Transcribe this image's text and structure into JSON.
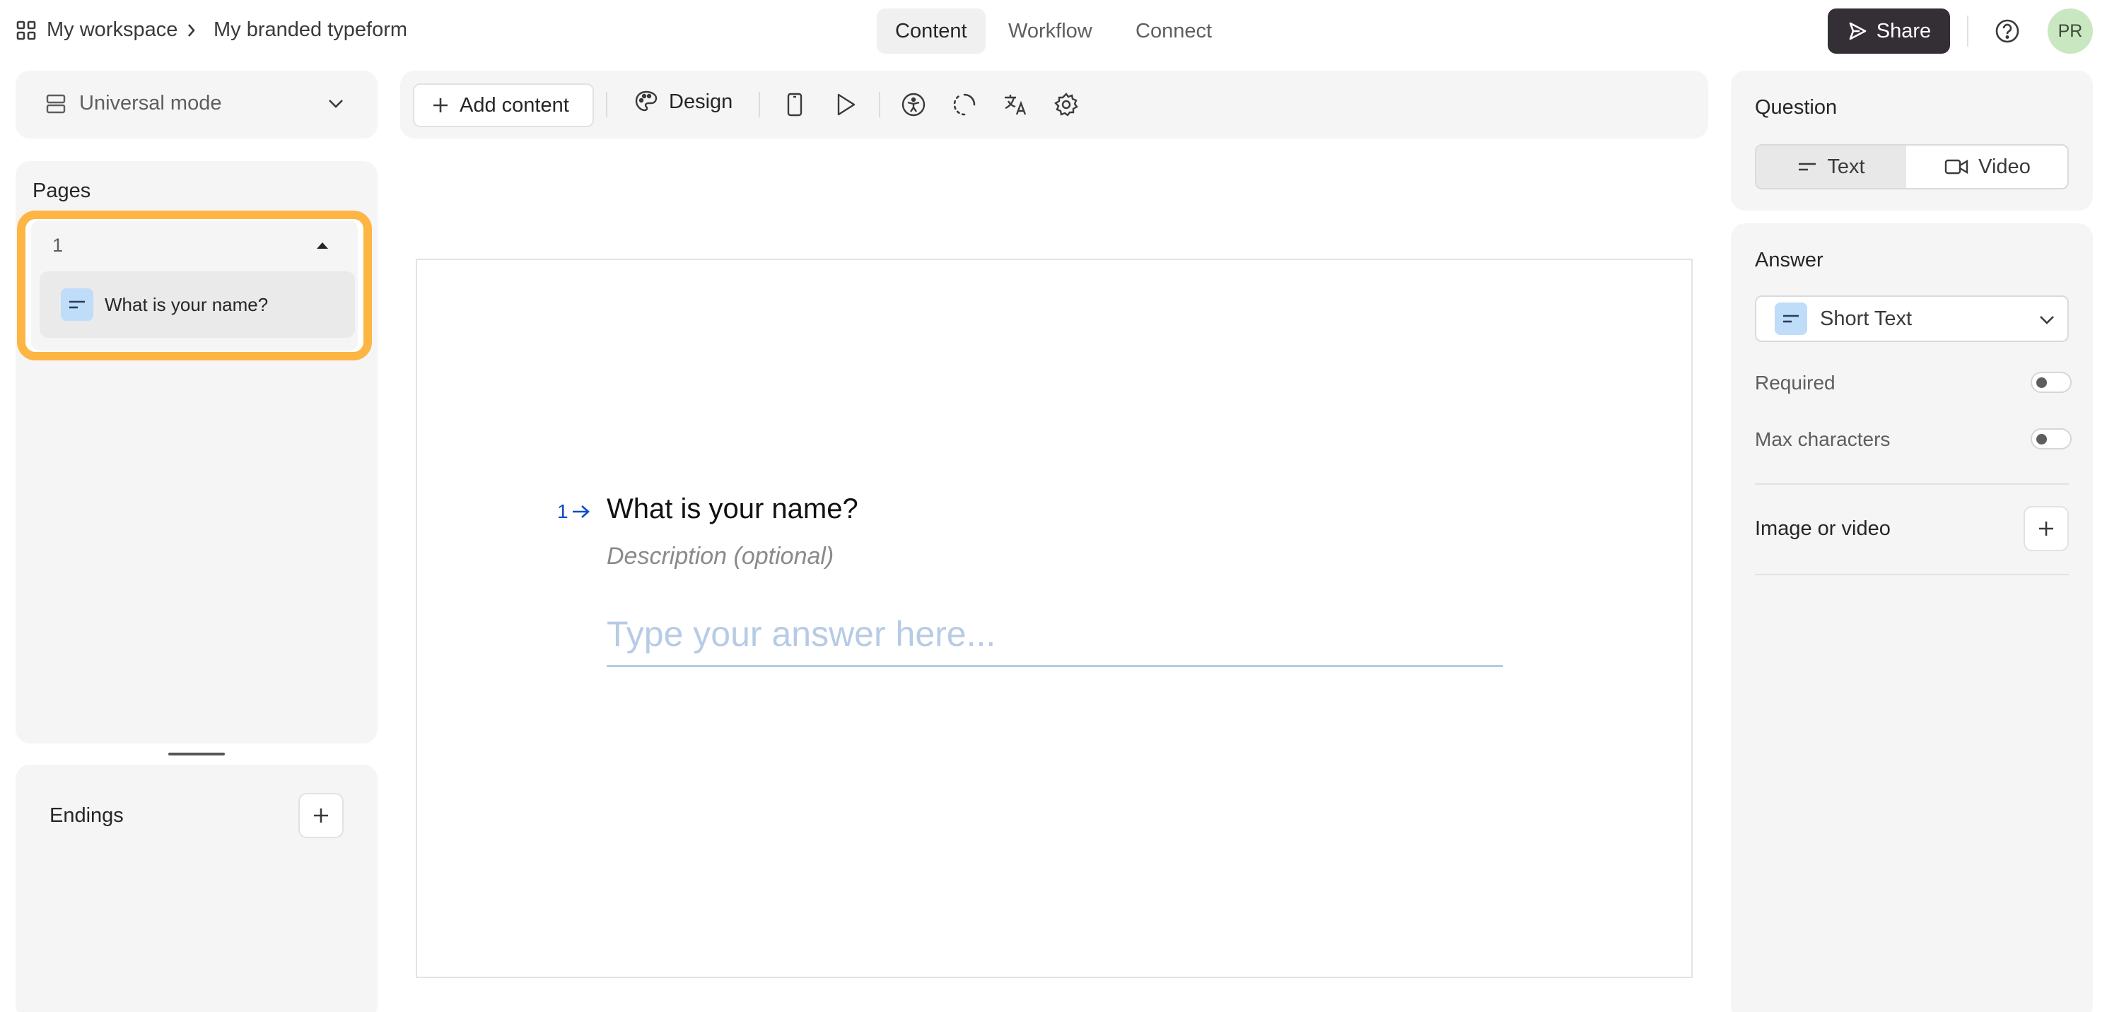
{
  "topbar": {
    "workspace": "My workspace",
    "form_name": "My branded typeform",
    "tabs": [
      "Content",
      "Workflow",
      "Connect"
    ],
    "share_label": "Share",
    "avatar_initials": "PR"
  },
  "left": {
    "mode_label": "Universal mode",
    "pages_title": "Pages",
    "page_number": "1",
    "page_item": "What is your name?",
    "endings_title": "Endings"
  },
  "toolbar": {
    "add_content": "Add content",
    "design": "Design"
  },
  "canvas": {
    "question_number": "1",
    "question_title": "What is your name?",
    "description_placeholder": "Description (optional)",
    "answer_placeholder": "Type your answer here..."
  },
  "right": {
    "question_title": "Question",
    "seg_text": "Text",
    "seg_video": "Video",
    "answer_title": "Answer",
    "answer_type": "Short Text",
    "required_label": "Required",
    "max_chars_label": "Max characters",
    "image_video_label": "Image or video"
  },
  "colors": {
    "highlight": "#fdb544",
    "share_bg": "#332f35",
    "accent_blue": "#0c4cc9",
    "placeholder_blue": "#b7cbe6"
  },
  "icons": [
    "grid-icon",
    "chevron-right-icon",
    "send-icon",
    "help-icon",
    "layout-icon",
    "chevron-down-icon",
    "plus-icon",
    "palette-icon",
    "phone-icon",
    "play-icon",
    "accessibility-icon",
    "loader-icon",
    "translate-icon",
    "gear-icon",
    "short-text-icon",
    "video-icon",
    "arrow-right-icon",
    "caret-up-icon"
  ]
}
